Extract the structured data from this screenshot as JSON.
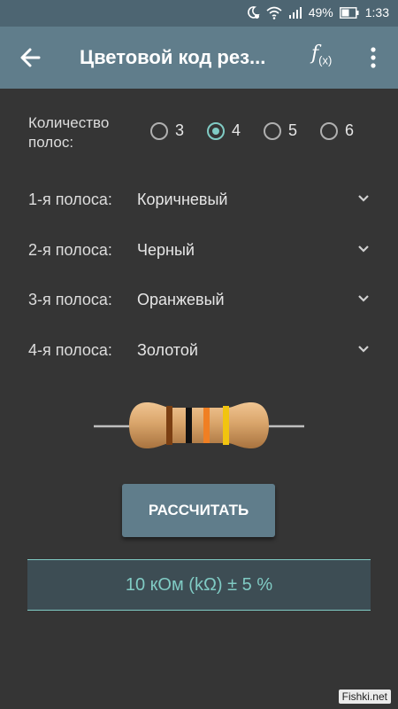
{
  "status": {
    "battery": "49%",
    "time": "1:33"
  },
  "app": {
    "title": "Цветовой код рез...",
    "fx_main": "f",
    "fx_sub": "(x)"
  },
  "band_count": {
    "label": "Количество\nполос:",
    "options": [
      "3",
      "4",
      "5",
      "6"
    ],
    "selected": "4"
  },
  "bands": [
    {
      "label": "1-я полоса:",
      "value": "Коричневый",
      "color": "#7b3f12"
    },
    {
      "label": "2-я полоса:",
      "value": "Черный",
      "color": "#111111"
    },
    {
      "label": "3-я полоса:",
      "value": "Оранжевый",
      "color": "#f07f23"
    },
    {
      "label": "4-я полоса:",
      "value": "Золотой",
      "color": "#f1c40f"
    }
  ],
  "calculate_label": "РАССЧИТАТЬ",
  "result": "10 кОм (kΩ) ± 5 %",
  "watermark": "Fishki.net",
  "colors": {
    "appbar": "#607d8b",
    "statusbar": "#4d6572",
    "background": "#353535",
    "accent": "#80cbc4",
    "resistor_body": "#d4a06a"
  }
}
